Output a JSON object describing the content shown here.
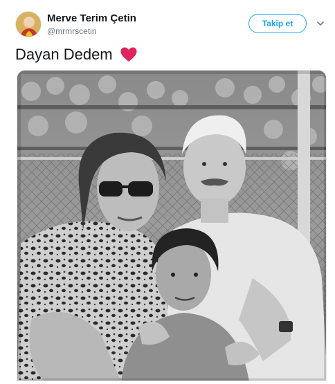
{
  "header": {
    "display_name": "Merve Terim Çetin",
    "handle": "@mrmrscetin",
    "follow_label": "Takip et",
    "avatar_icon": "profile-avatar",
    "menu_icon": "chevron-down-icon"
  },
  "tweet": {
    "text": "Dayan Dedem",
    "emoji": "red-heart",
    "heart_color": "#e0245e"
  },
  "colors": {
    "accent": "#1da1f2",
    "text": "#14171a",
    "secondary_text": "#657786"
  }
}
